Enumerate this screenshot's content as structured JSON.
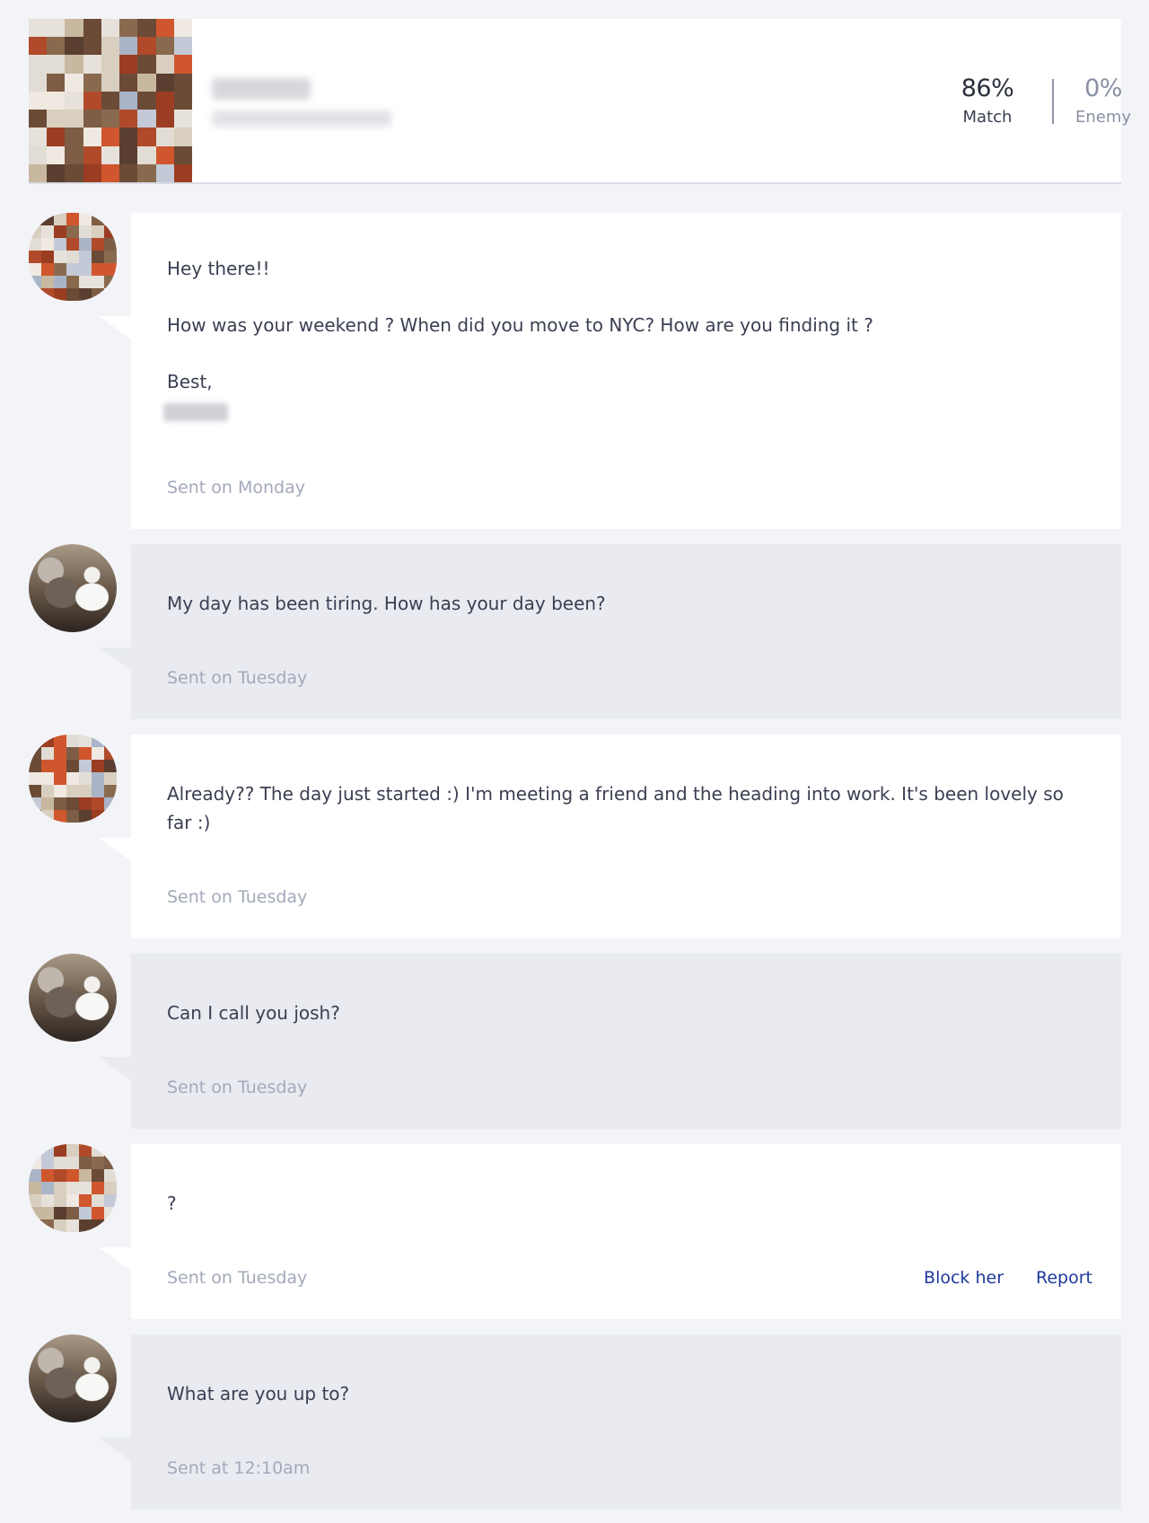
{
  "profile": {
    "stats": {
      "match_value": "86%",
      "match_label": "Match",
      "enemy_value": "0%",
      "enemy_label": "Enemy"
    }
  },
  "messages": [
    {
      "sender": "her",
      "lines": [
        "Hey there!!",
        "How was your weekend ? When did you move to NYC? How are you finding it ?",
        "Best,"
      ],
      "sent": "Sent on Monday"
    },
    {
      "sender": "me",
      "text": "My day has been tiring. How has your day been?",
      "sent": "Sent on Tuesday"
    },
    {
      "sender": "her",
      "text": "Already?? The day just started :) I'm meeting a friend and the heading into work. It's been lovely so far :)",
      "sent": "Sent on Tuesday"
    },
    {
      "sender": "me",
      "text": "Can I call you josh?",
      "sent": "Sent on Tuesday"
    },
    {
      "sender": "her",
      "text": "?",
      "sent": "Sent on Tuesday",
      "actions": {
        "block": "Block her",
        "report": "Report"
      }
    },
    {
      "sender": "me",
      "text": "What are you up to?",
      "sent": "Sent at 12:10am"
    }
  ],
  "colors": {
    "page_bg": "#f3f4f8",
    "her_bubble": "#ffffff",
    "my_bubble": "#e9ebf1",
    "link": "#1e3a9c",
    "muted": "#a3a9ba"
  }
}
